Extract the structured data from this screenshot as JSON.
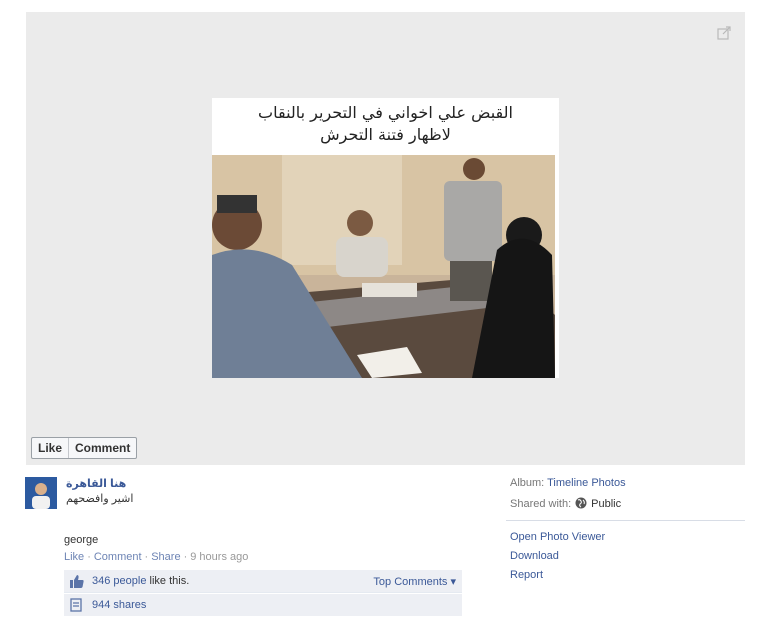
{
  "photo": {
    "caption_line1": "القبض علي اخواني في التحرير بالنقاب",
    "caption_line2": "لاظهار فتنة التحرش"
  },
  "buttons": {
    "like": "Like",
    "comment": "Comment"
  },
  "post": {
    "page_name": "هنا القاهرة",
    "text": "اشير وافضحهم"
  },
  "comment": {
    "author": "george",
    "actions": {
      "like": "Like",
      "comment": "Comment",
      "share": "Share",
      "time": "9 hours ago"
    }
  },
  "stats": {
    "likes_link": "346 people",
    "likes_suffix": " like this.",
    "top_comments": "Top Comments",
    "shares": "944 shares"
  },
  "meta": {
    "album_label": "Album:",
    "album_value": "Timeline Photos",
    "shared_label": "Shared with:",
    "shared_value": "Public"
  },
  "options": [
    "Open Photo Viewer",
    "Download",
    "Report"
  ],
  "icons": {
    "expand": "expand-icon",
    "thumb": "thumbs-up-icon",
    "share": "share-icon",
    "globe": "globe-icon",
    "dropdown": "caret-down-icon"
  },
  "colors": {
    "link": "#3b5998",
    "stage_bg": "#ebebeb",
    "stats_bg": "#edeff4"
  }
}
